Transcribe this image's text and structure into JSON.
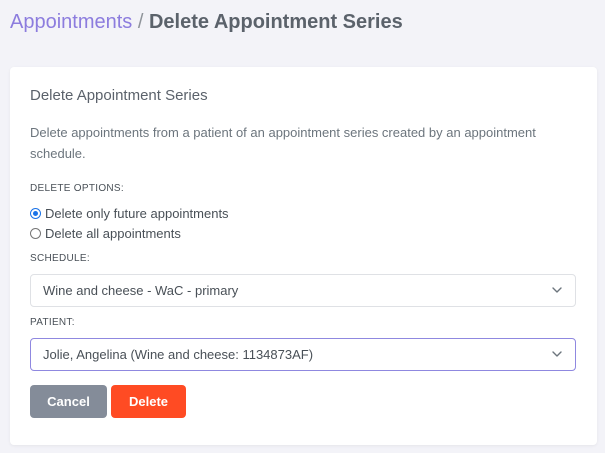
{
  "breadcrumb": {
    "parent": "Appointments",
    "separator": " / ",
    "current": "Delete Appointment Series"
  },
  "card": {
    "title": "Delete Appointment Series",
    "description": "Delete appointments from a patient of an appointment series created by an appointment schedule."
  },
  "delete_options": {
    "label": "DELETE OPTIONS:",
    "options": [
      {
        "label": "Delete only future appointments",
        "checked": true
      },
      {
        "label": "Delete all appointments",
        "checked": false
      }
    ]
  },
  "schedule": {
    "label": "SCHEDULE:",
    "value": "Wine and cheese - WaC - primary"
  },
  "patient": {
    "label": "PATIENT:",
    "value": "Jolie, Angelina (Wine and cheese: 1134873AF)"
  },
  "buttons": {
    "cancel": "Cancel",
    "delete": "Delete"
  },
  "colors": {
    "accent": "#8c7cde",
    "cancel": "#848c99",
    "delete": "#ff4b23"
  },
  "icons": {
    "select_chevron": "chevron-down-icon"
  }
}
